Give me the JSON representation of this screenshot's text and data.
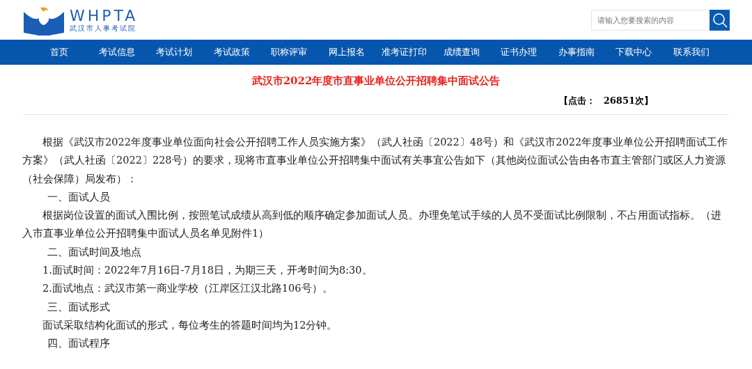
{
  "header": {
    "logo_text": "WHPTA",
    "logo_subtitle": "武汉市人事考试院",
    "search": {
      "placeholder": "请输入您要搜索的内容"
    }
  },
  "nav": [
    "首页",
    "考试信息",
    "考试计划",
    "考试政策",
    "职称评审",
    "网上报名",
    "准考证打印",
    "成绩查询",
    "证书办理",
    "办事指南",
    "下载中心",
    "联系我们"
  ],
  "article": {
    "title": "武汉市2022年度市直事业单位公开招聘集中面试公告",
    "clicks_label": "【点击：",
    "clicks_count": "26851次】",
    "blocks": [
      {
        "kind": "paragraph",
        "text": "根据《武汉市2022年度事业单位面向社会公开招聘工作人员实施方案》（武人社函〔2022〕48号）和《武汉市2022年度事业单位公开招聘面试工作方案》（武人社函〔2022〕228号）的要求，现将市直事业单位公开招聘集中面试有关事宜公告如下（其他岗位面试公告由各市直主管部门或区人力资源（社会保障）局发布）："
      },
      {
        "kind": "heading",
        "text": "一、面试人员"
      },
      {
        "kind": "paragraph",
        "text": "根据岗位设置的面试入围比例，按照笔试成绩从高到低的顺序确定参加面试人员。办理免笔试手续的人员不受面试比例限制，不占用面试指标。（进入市直事业单位公开招聘集中面试人员名单见附件1）"
      },
      {
        "kind": "heading",
        "text": "二、面试时间及地点"
      },
      {
        "kind": "paragraph",
        "text": "1.面试时间：2022年7月16日-7月18日，为期三天，开考时间为8:30。"
      },
      {
        "kind": "paragraph",
        "text": "2.面试地点：武汉市第一商业学校（江岸区江汉北路106号）。"
      },
      {
        "kind": "heading",
        "text": "三、面试形式"
      },
      {
        "kind": "paragraph",
        "text": "面试采取结构化面试的形式，每位考生的答题时间均为12分钟。"
      },
      {
        "kind": "heading",
        "text": "四、面试程序"
      }
    ]
  }
}
